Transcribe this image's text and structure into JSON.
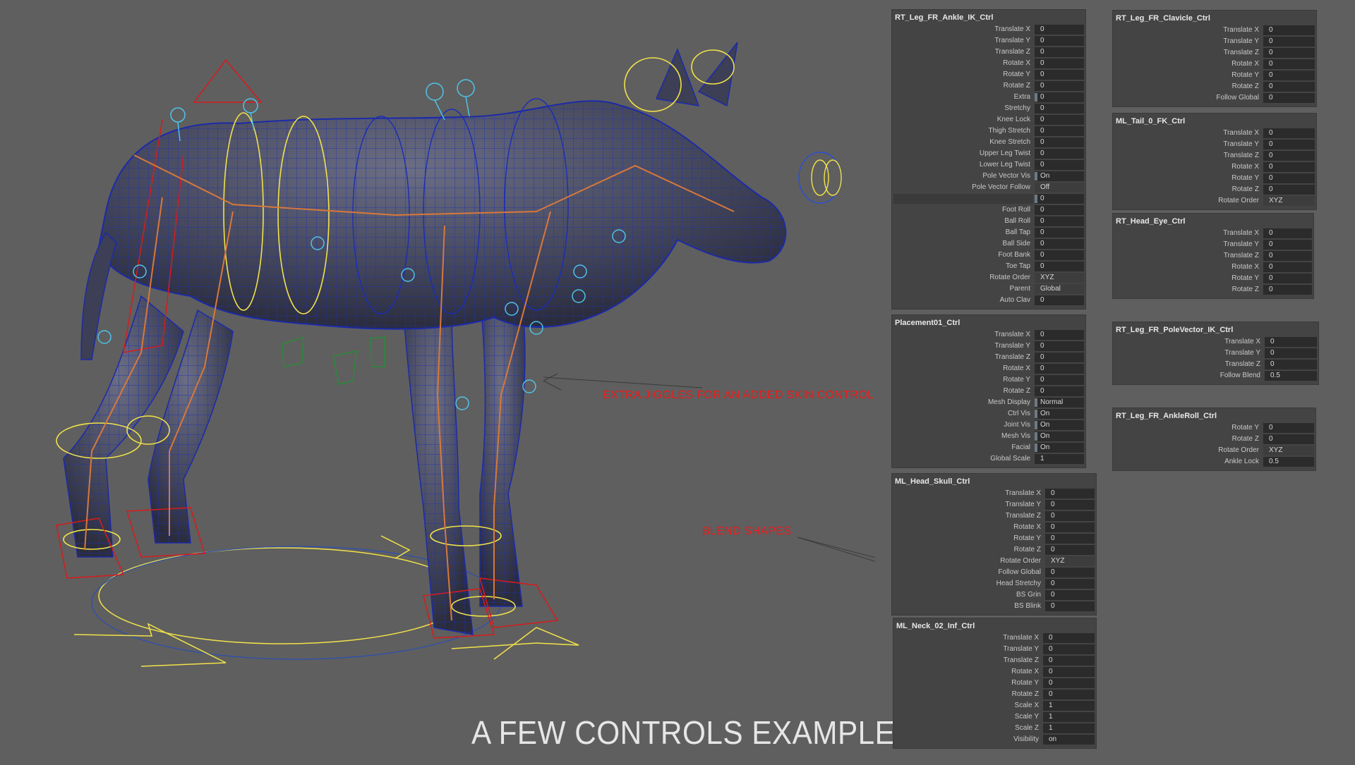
{
  "footer_title": "A FEW CONTROLS EXAMPLE",
  "annotations": {
    "jiggles": "EXTRA JIGGLES FOR AN ADDED SKIN CONTROL",
    "blend_shapes": "BLEND SHAPES"
  },
  "colors": {
    "background": "#5f5f5f",
    "panel": "#444444",
    "field": "#2b2b2b",
    "annotation": "#ee1a1a",
    "wire_yellow": "#f1e24a",
    "wire_blue": "#1a2db8",
    "wire_cyan": "#4fc3e8",
    "wire_red": "#d81b1b",
    "wire_green": "#2a8a3a"
  },
  "panels": [
    {
      "id": "rt-leg-fr-ankle-ik",
      "title": "RT_Leg_FR_Ankle_IK_Ctrl",
      "rows": [
        {
          "label": "Translate X",
          "value": "0"
        },
        {
          "label": "Translate Y",
          "value": "0"
        },
        {
          "label": "Translate Z",
          "value": "0"
        },
        {
          "label": "Rotate X",
          "value": "0"
        },
        {
          "label": "Rotate Y",
          "value": "0"
        },
        {
          "label": "Rotate Z",
          "value": "0"
        },
        {
          "label": "Extra",
          "value": "0",
          "kind": "mark"
        },
        {
          "label": "Stretchy",
          "value": "0"
        },
        {
          "label": "Knee Lock",
          "value": "0"
        },
        {
          "label": "Thigh Stretch",
          "value": "0"
        },
        {
          "label": "Knee Stretch",
          "value": "0"
        },
        {
          "label": "Upper Leg Twist",
          "value": "0"
        },
        {
          "label": "Lower Leg Twist",
          "value": "0"
        },
        {
          "label": "Pole Vector Vis",
          "value": "On",
          "kind": "mark"
        },
        {
          "label": "Pole Vector Follow",
          "value": "Off",
          "kind": "enum"
        },
        {
          "label": "",
          "value": "0",
          "kind": "mark-empty"
        },
        {
          "label": "Foot Roll",
          "value": "0"
        },
        {
          "label": "Ball Roll",
          "value": "0"
        },
        {
          "label": "Ball Tap",
          "value": "0"
        },
        {
          "label": "Ball Side",
          "value": "0"
        },
        {
          "label": "Foot Bank",
          "value": "0"
        },
        {
          "label": "Toe Tap",
          "value": "0"
        },
        {
          "label": "Rotate Order",
          "value": "XYZ",
          "kind": "enum"
        },
        {
          "label": "Parent",
          "value": "Global",
          "kind": "enum"
        },
        {
          "label": "Auto Clav",
          "value": "0"
        }
      ]
    },
    {
      "id": "placement01",
      "title": "Placement01_Ctrl",
      "rows": [
        {
          "label": "Translate X",
          "value": "0"
        },
        {
          "label": "Translate Y",
          "value": "0"
        },
        {
          "label": "Translate Z",
          "value": "0"
        },
        {
          "label": "Rotate X",
          "value": "0"
        },
        {
          "label": "Rotate Y",
          "value": "0"
        },
        {
          "label": "Rotate Z",
          "value": "0"
        },
        {
          "label": "Mesh Display",
          "value": "Normal",
          "kind": "mark"
        },
        {
          "label": "Ctrl Vis",
          "value": "On",
          "kind": "mark"
        },
        {
          "label": "Joint Vis",
          "value": "On",
          "kind": "mark"
        },
        {
          "label": "Mesh Vis",
          "value": "On",
          "kind": "mark"
        },
        {
          "label": "Facial",
          "value": "On",
          "kind": "mark"
        },
        {
          "label": "Global Scale",
          "value": "1"
        }
      ]
    },
    {
      "id": "ml-head-skull",
      "title": "ML_Head_Skull_Ctrl",
      "rows": [
        {
          "label": "Translate X",
          "value": "0"
        },
        {
          "label": "Translate Y",
          "value": "0"
        },
        {
          "label": "Translate Z",
          "value": "0"
        },
        {
          "label": "Rotate X",
          "value": "0"
        },
        {
          "label": "Rotate Y",
          "value": "0"
        },
        {
          "label": "Rotate Z",
          "value": "0"
        },
        {
          "label": "Rotate Order",
          "value": "XYZ",
          "kind": "enum"
        },
        {
          "label": "Follow Global",
          "value": "0"
        },
        {
          "label": "Head Stretchy",
          "value": "0"
        },
        {
          "label": "BS Grin",
          "value": "0"
        },
        {
          "label": "BS Blink",
          "value": "0"
        }
      ]
    },
    {
      "id": "ml-neck-02-inf",
      "title": "ML_Neck_02_Inf_Ctrl",
      "rows": [
        {
          "label": "Translate X",
          "value": "0"
        },
        {
          "label": "Translate Y",
          "value": "0"
        },
        {
          "label": "Translate Z",
          "value": "0"
        },
        {
          "label": "Rotate X",
          "value": "0"
        },
        {
          "label": "Rotate Y",
          "value": "0"
        },
        {
          "label": "Rotate Z",
          "value": "0"
        },
        {
          "label": "Scale X",
          "value": "1"
        },
        {
          "label": "Scale Y",
          "value": "1"
        },
        {
          "label": "Scale Z",
          "value": "1"
        },
        {
          "label": "Visibility",
          "value": "on"
        }
      ]
    },
    {
      "id": "rt-leg-fr-clavicle",
      "title": "RT_Leg_FR_Clavicle_Ctrl",
      "rows": [
        {
          "label": "Translate X",
          "value": "0"
        },
        {
          "label": "Translate Y",
          "value": "0"
        },
        {
          "label": "Translate Z",
          "value": "0"
        },
        {
          "label": "Rotate X",
          "value": "0"
        },
        {
          "label": "Rotate Y",
          "value": "0"
        },
        {
          "label": "Rotate Z",
          "value": "0"
        },
        {
          "label": "Follow Global",
          "value": "0"
        }
      ]
    },
    {
      "id": "ml-tail-0-fk",
      "title": "ML_Tail_0_FK_Ctrl",
      "rows": [
        {
          "label": "Translate X",
          "value": "0"
        },
        {
          "label": "Translate Y",
          "value": "0"
        },
        {
          "label": "Translate Z",
          "value": "0"
        },
        {
          "label": "Rotate X",
          "value": "0"
        },
        {
          "label": "Rotate Y",
          "value": "0"
        },
        {
          "label": "Rotate Z",
          "value": "0"
        },
        {
          "label": "Rotate Order",
          "value": "XYZ",
          "kind": "enum"
        }
      ]
    },
    {
      "id": "rt-head-eye",
      "title": "RT_Head_Eye_Ctrl",
      "rows": [
        {
          "label": "Translate X",
          "value": "0"
        },
        {
          "label": "Translate Y",
          "value": "0"
        },
        {
          "label": "Translate Z",
          "value": "0"
        },
        {
          "label": "Rotate X",
          "value": "0"
        },
        {
          "label": "Rotate Y",
          "value": "0"
        },
        {
          "label": "Rotate Z",
          "value": "0"
        }
      ]
    },
    {
      "id": "rt-leg-fr-polevector-ik",
      "title": "RT_Leg_FR_PoleVector_IK_Ctrl",
      "rows": [
        {
          "label": "Translate X",
          "value": "0"
        },
        {
          "label": "Translate Y",
          "value": "0"
        },
        {
          "label": "Translate Z",
          "value": "0"
        },
        {
          "label": "Follow Blend",
          "value": "0.5"
        }
      ]
    },
    {
      "id": "rt-leg-fr-ankleroll",
      "title": "RT_Leg_FR_AnkleRoll_Ctrl",
      "rows": [
        {
          "label": "Rotate Y",
          "value": "0"
        },
        {
          "label": "Rotate Z",
          "value": "0"
        },
        {
          "label": "Rotate Order",
          "value": "XYZ",
          "kind": "enum"
        },
        {
          "label": "Ankle Lock",
          "value": "0.5"
        }
      ]
    }
  ]
}
